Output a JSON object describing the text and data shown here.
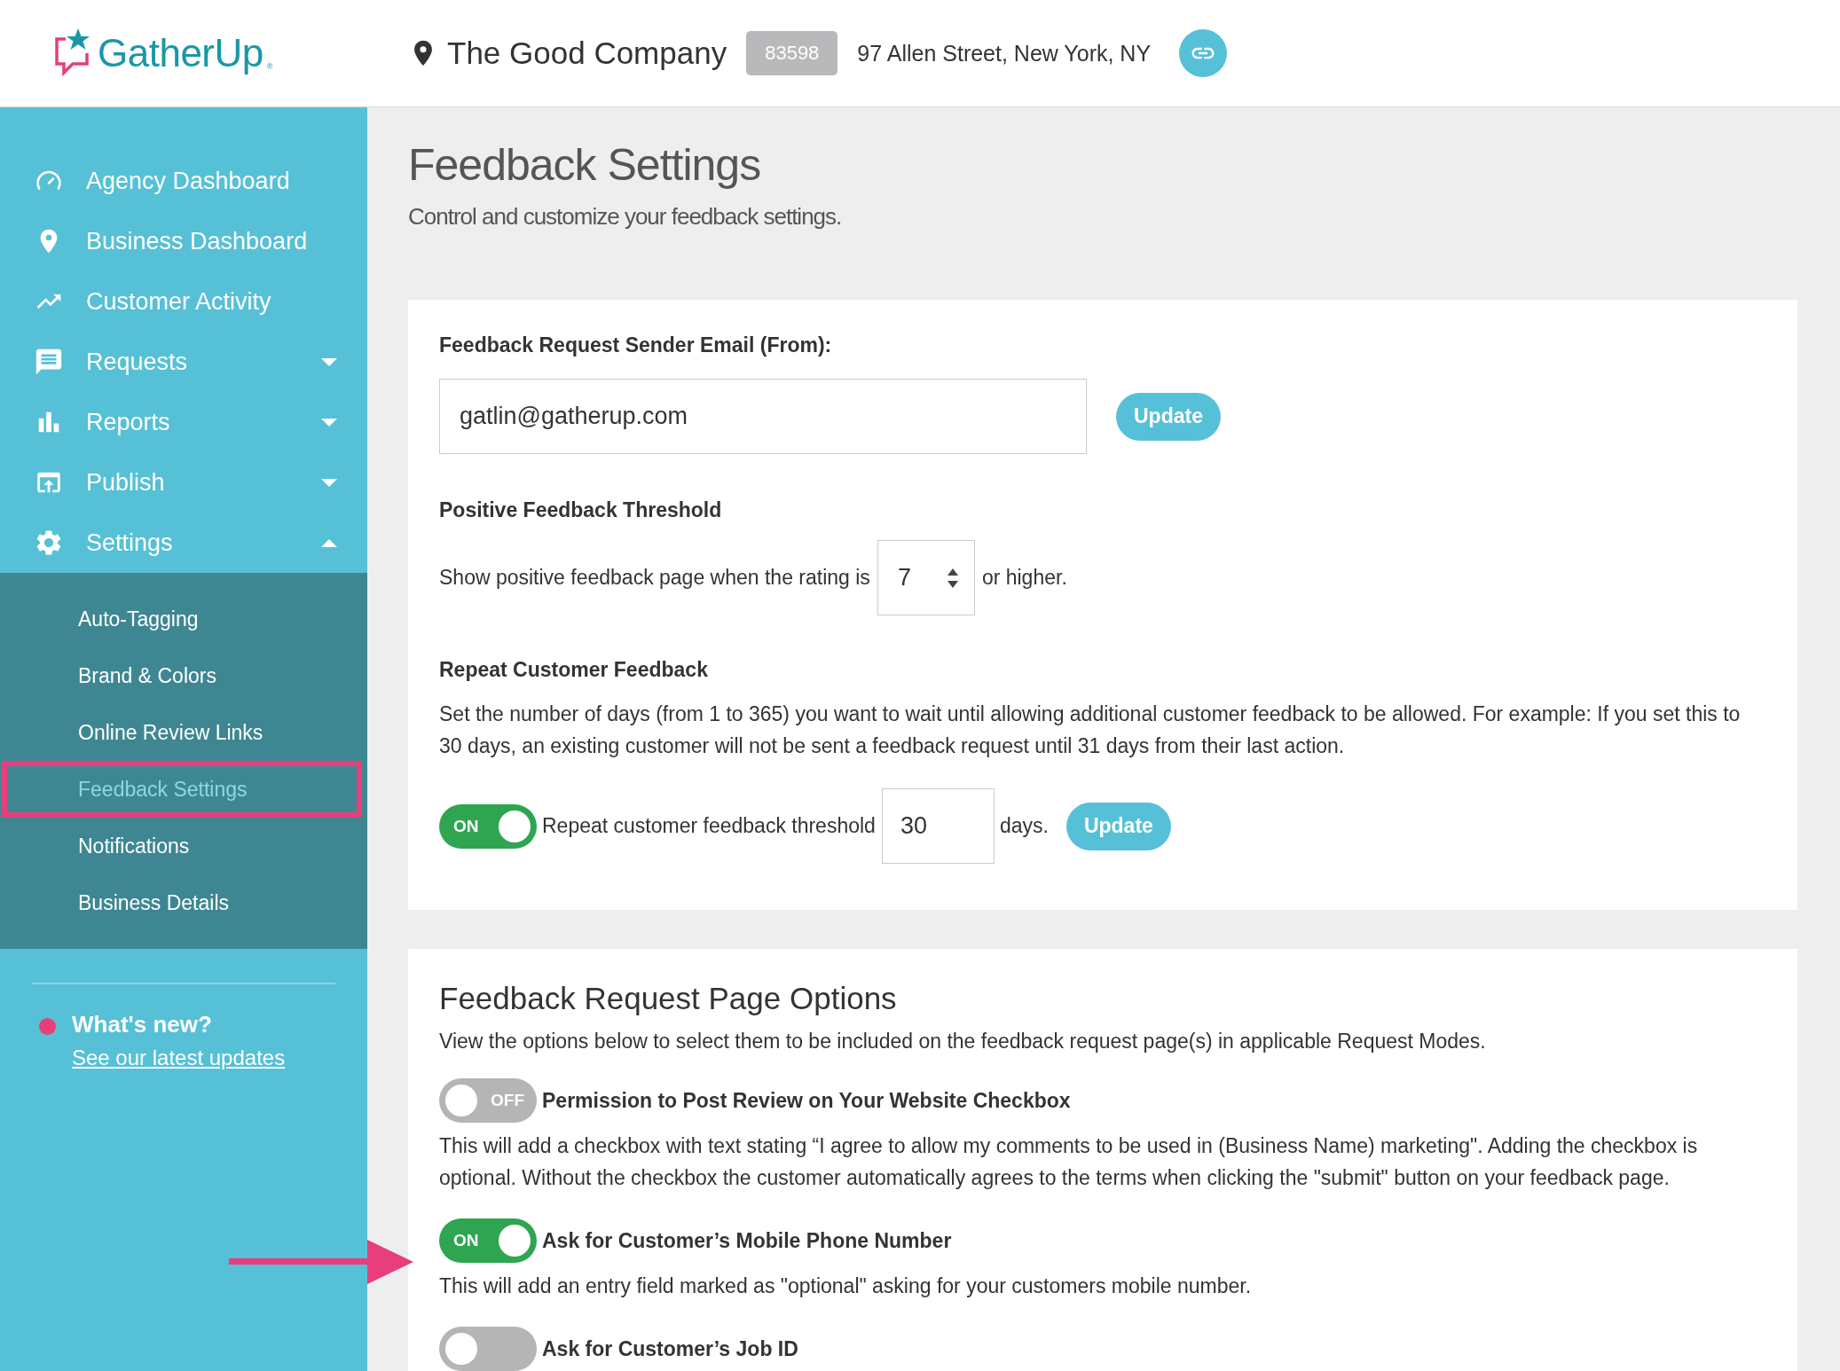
{
  "header": {
    "brand": "GatherUp",
    "trademark": "®",
    "location_name": "The Good Company",
    "location_id": "83598",
    "address": "97 Allen Street, New York, NY"
  },
  "sidebar": {
    "items": [
      {
        "label": "Agency Dashboard"
      },
      {
        "label": "Business Dashboard"
      },
      {
        "label": "Customer Activity"
      },
      {
        "label": "Requests",
        "expanded": false
      },
      {
        "label": "Reports",
        "expanded": false
      },
      {
        "label": "Publish",
        "expanded": false
      },
      {
        "label": "Settings",
        "expanded": true,
        "children": [
          {
            "label": "Auto-Tagging",
            "selected": false
          },
          {
            "label": "Brand & Colors",
            "selected": false
          },
          {
            "label": "Online Review Links",
            "selected": false
          },
          {
            "label": "Feedback Settings",
            "selected": true
          },
          {
            "label": "Notifications",
            "selected": false
          },
          {
            "label": "Business Details",
            "selected": false
          }
        ]
      }
    ],
    "whats_new": {
      "title": "What's new?",
      "link": "See our latest updates"
    }
  },
  "page": {
    "title": "Feedback Settings",
    "subtitle": "Control and customize your feedback settings."
  },
  "general_card": {
    "sender_email": {
      "label": "Feedback Request Sender Email (From):",
      "value": "gatlin@gatherup.com",
      "button": "Update"
    },
    "threshold": {
      "heading": "Positive Feedback Threshold",
      "text_before": "Show positive feedback page when the rating is",
      "value": "7",
      "text_after": "or higher."
    },
    "repeat": {
      "heading": "Repeat Customer Feedback",
      "description": "Set the number of days (from 1 to 365) you want to wait until allowing additional customer feedback to be allowed. For example: If you set this to 30 days, an existing customer will not be sent a feedback request until 31 days from their last action.",
      "toggle": {
        "on": true,
        "text": "ON"
      },
      "label": "Repeat customer feedback threshold",
      "value": "30",
      "unit": "days.",
      "button": "Update"
    }
  },
  "options_card": {
    "title": "Feedback Request Page Options",
    "description": "View the options below to select them to be included on the feedback request page(s) in applicable Request Modes.",
    "options": [
      {
        "on": false,
        "toggle_text": "OFF",
        "title": "Permission to Post Review on Your Website Checkbox",
        "description": "This will add a checkbox with text stating “I agree to allow my comments to be used in (Business Name) marketing\". Adding the checkbox is optional. Without the checkbox the customer automatically agrees to the terms when clicking the \"submit\" button on your feedback page."
      },
      {
        "on": true,
        "toggle_text": "ON",
        "title": "Ask for Customer’s Mobile Phone Number",
        "description": "This will add an entry field marked as \"optional\" asking for your customers mobile number."
      },
      {
        "on": false,
        "title": "Ask for Customer’s Job ID"
      }
    ]
  }
}
